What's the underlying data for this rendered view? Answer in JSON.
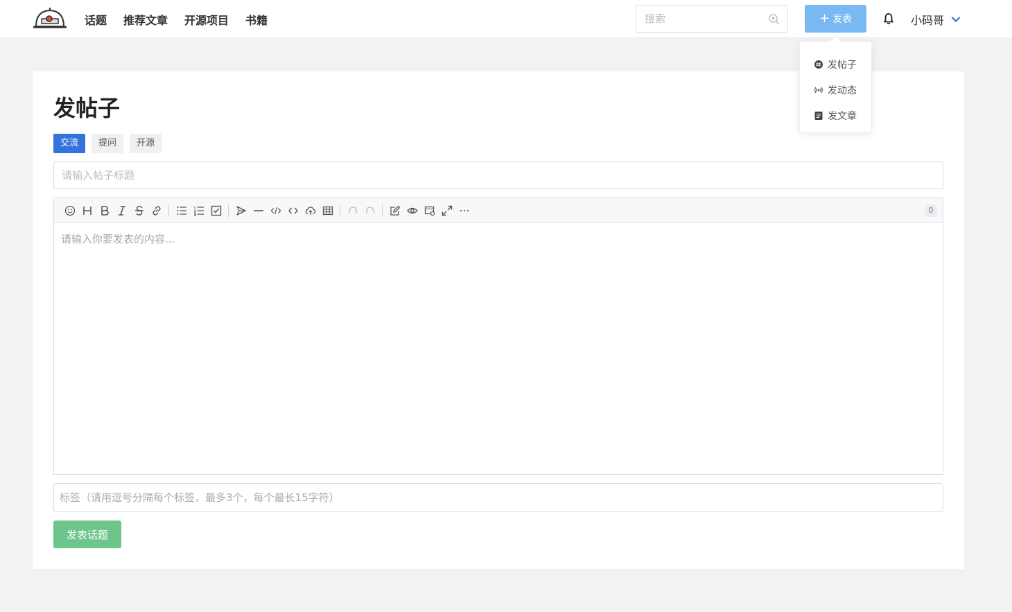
{
  "nav": {
    "items": [
      "话题",
      "推荐文章",
      "开源项目",
      "书籍"
    ]
  },
  "search": {
    "placeholder": "搜索"
  },
  "header": {
    "publish_label": "发表",
    "user_name": "小码哥"
  },
  "dropdown": {
    "items": [
      {
        "label": "发帖子",
        "icon": "chat-bubble-icon"
      },
      {
        "label": "发动态",
        "icon": "broadcast-icon"
      },
      {
        "label": "发文章",
        "icon": "document-icon"
      }
    ]
  },
  "page": {
    "title": "发帖子",
    "categories": [
      {
        "label": "交流",
        "active": true
      },
      {
        "label": "提问",
        "active": false
      },
      {
        "label": "开源",
        "active": false
      }
    ],
    "title_placeholder": "请输入帖子标题",
    "content_placeholder": "请输入你要发表的内容...",
    "char_count": "0",
    "tags_placeholder": "标签（请用逗号分隔每个标签，最多3个，每个最长15字符）",
    "submit_label": "发表话题"
  },
  "colors": {
    "accent": "#3273dc",
    "publish": "#79b8f3",
    "submit": "#6cc58a"
  }
}
